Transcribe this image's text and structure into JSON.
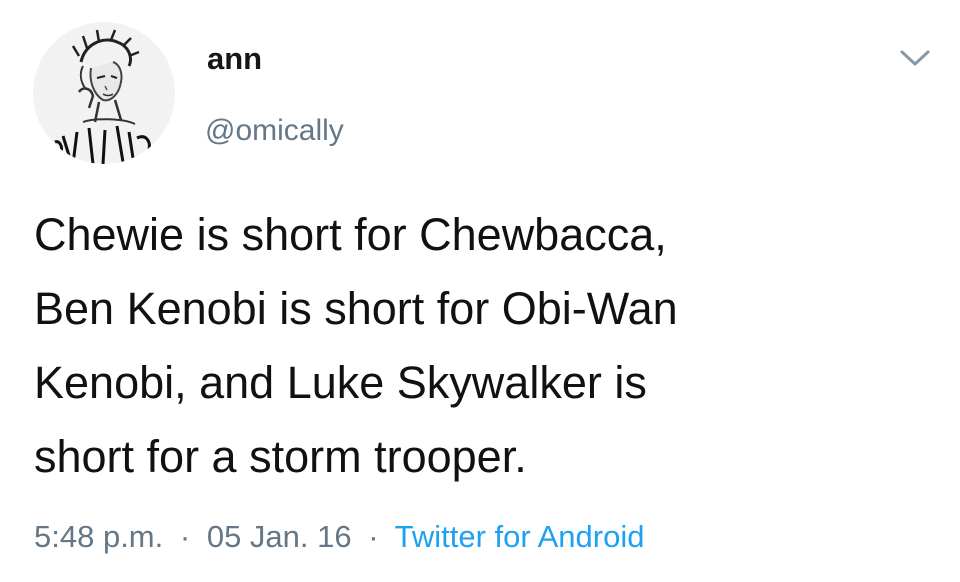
{
  "user": {
    "display_name": "ann",
    "handle": "@omically"
  },
  "tweet": {
    "lines": [
      "Chewie is short for Chewbacca,",
      "Ben Kenobi is short for Obi-Wan",
      "Kenobi, and Luke Skywalker is",
      "short for a storm trooper."
    ]
  },
  "meta": {
    "time": "5:48 p.m.",
    "separator": "·",
    "date": "05 Jan. 16",
    "source": "Twitter for Android"
  },
  "icons": {
    "menu": "chevron-down-icon",
    "avatar": "avatar-portrait"
  },
  "colors": {
    "text": "#14171a",
    "secondary": "#657786",
    "link": "#1da1f2"
  }
}
